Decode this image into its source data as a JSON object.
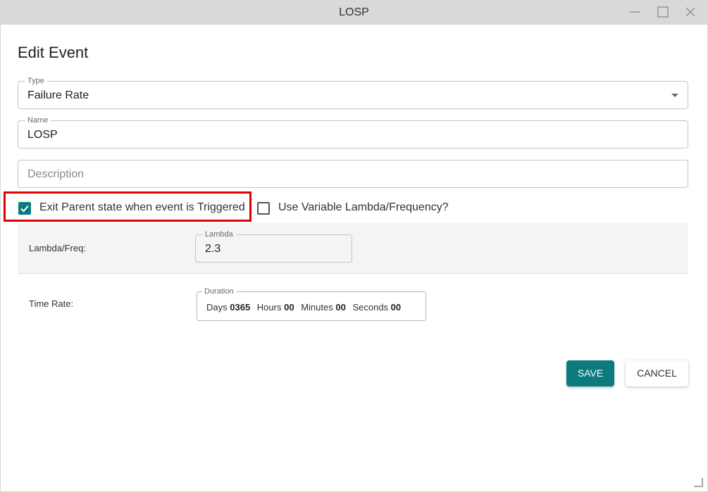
{
  "window": {
    "title": "LOSP",
    "controls": {
      "minimize_icon": "minimize-icon",
      "maximize_icon": "maximize-icon",
      "close_icon": "close-icon"
    }
  },
  "dialog": {
    "heading": "Edit Event",
    "type_field": {
      "legend": "Type",
      "value": "Failure Rate",
      "icon": "chevron-down-icon"
    },
    "name_field": {
      "legend": "Name",
      "value": "LOSP"
    },
    "description_field": {
      "placeholder": "Description",
      "value": ""
    },
    "exit_parent_checkbox": {
      "label": "Exit Parent state when event is Triggered",
      "checked": true
    },
    "variable_lambda_checkbox": {
      "label": "Use Variable Lambda/Frequency?",
      "checked": false
    },
    "lambda_row": {
      "label": "Lambda/Freq:",
      "field_legend": "Lambda",
      "value": "2.3"
    },
    "time_rate_row": {
      "label": "Time Rate:",
      "field_legend": "Duration",
      "days_label": "Days",
      "days_value": "0365",
      "hours_label": "Hours",
      "hours_value": "00",
      "minutes_label": "Minutes",
      "minutes_value": "00",
      "seconds_label": "Seconds",
      "seconds_value": "00"
    },
    "buttons": {
      "save": "SAVE",
      "cancel": "CANCEL"
    }
  },
  "colors": {
    "accent": "#0b7b7d",
    "highlight": "#e00000",
    "titlebar": "#d9d9d9",
    "row_background": "#f4f4f4"
  }
}
